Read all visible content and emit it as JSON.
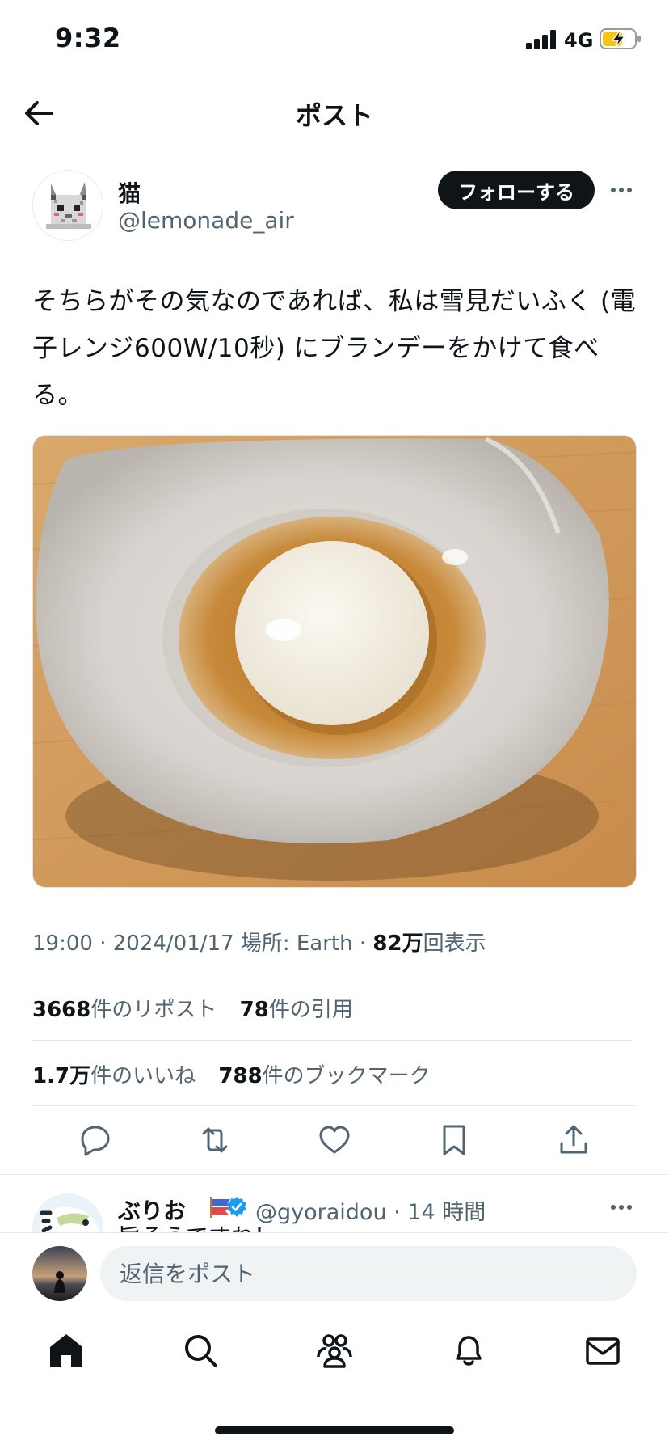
{
  "status_bar": {
    "time": "9:32",
    "network": "4G"
  },
  "header": {
    "title": "ポスト"
  },
  "author": {
    "name": "猫",
    "handle": "@lemonade_air",
    "follow_label": "フォローする"
  },
  "tweet": {
    "text": "そちらがその気なのであれば、私は雪見だいふく (電子レンジ600W/10秒) にブランデーをかけて食べる。"
  },
  "meta": {
    "time": "19:00",
    "date": "2024/01/17",
    "location": "場所: Earth",
    "views_count": "82万",
    "views_label": "回表示"
  },
  "stats": {
    "reposts_count": "3668",
    "reposts_label": "件のリポスト",
    "quotes_count": "78",
    "quotes_label": "件の引用",
    "likes_count": "1.7万",
    "likes_label": "件のいいね",
    "bookmarks_count": "788",
    "bookmarks_label": "件のブックマーク"
  },
  "actions": [
    "reply-icon",
    "repost-icon",
    "like-icon",
    "bookmark-icon",
    "share-icon"
  ],
  "reply": {
    "name": "ぶりお",
    "handle": "@gyoraidou",
    "time": "14 時間",
    "text": "旨そうですね！"
  },
  "composer": {
    "placeholder": "返信をポスト"
  },
  "tabs": [
    "home-icon",
    "search-icon",
    "communities-icon",
    "notifications-icon",
    "messages-icon"
  ],
  "colors": {
    "text": "#0f1419",
    "secondary": "#536471",
    "verified": "#1d9bf0",
    "input_bg": "#eff3f4"
  }
}
